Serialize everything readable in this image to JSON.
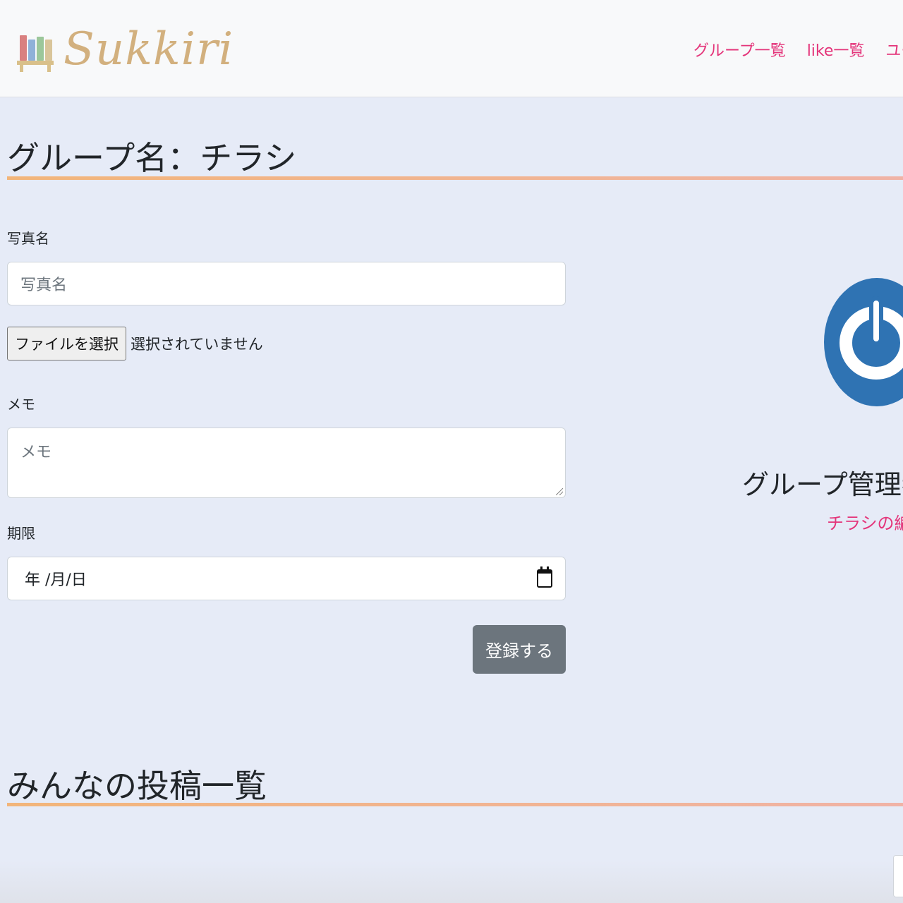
{
  "navbar": {
    "brand": "Sukkiri",
    "links": [
      "グループ一覧",
      "like一覧",
      "ユーザー"
    ]
  },
  "page": {
    "title": "グループ名：チラシ"
  },
  "form": {
    "photo_name_label": "写真名",
    "photo_name_placeholder": "写真名",
    "file_button_label": "ファイルを選択",
    "file_status": "選択されていません",
    "memo_label": "メモ",
    "memo_placeholder": "メモ",
    "deadline_label": "期限",
    "deadline_value": "年 /月/日",
    "submit_label": "登録する"
  },
  "sidebar": {
    "admin_title": "グループ管理者",
    "edit_link": "チラシの編集"
  },
  "posts": {
    "title": "みんなの投稿一覧"
  }
}
